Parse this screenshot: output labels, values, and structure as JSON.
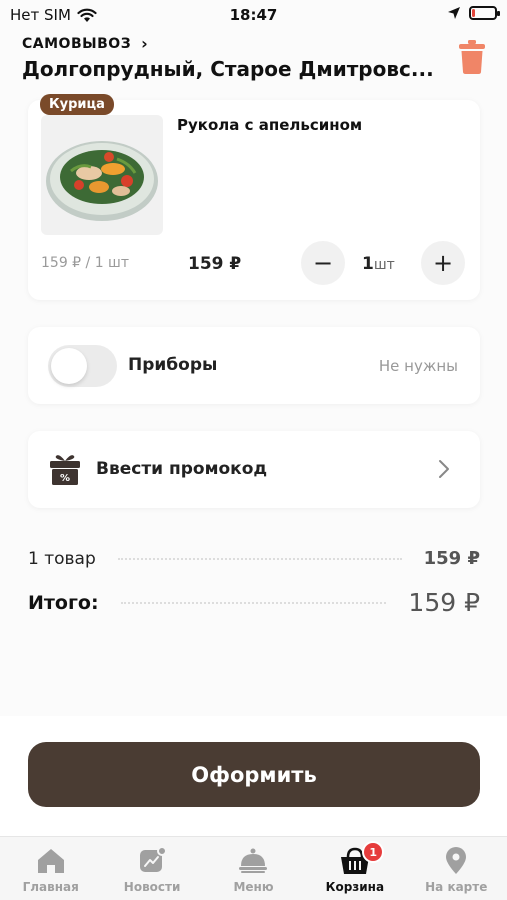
{
  "status_bar": {
    "carrier": "Нет SIM",
    "time": "18:47",
    "battery_level": 0.15
  },
  "header": {
    "mode_label": "САМОВЫВОЗ",
    "address": "Долгопрудный, Старое Дмитровс..."
  },
  "cart_item": {
    "tag": "Курица",
    "title": "Рукола с апельсином",
    "unit_price": "159 ₽ / 1 шт",
    "line_price": "159 ₽",
    "quantity": "1",
    "quantity_unit": "шт",
    "minus_symbol": "−",
    "plus_symbol": "+"
  },
  "cutlery": {
    "label": "Приборы",
    "value": "Не нужны",
    "enabled": false
  },
  "promo": {
    "label": "Ввести промокод"
  },
  "summary": {
    "items_label": "1 товар",
    "items_value": "159 ₽",
    "total_label": "Итого:",
    "total_value": "159 ₽"
  },
  "checkout": {
    "label": "Оформить"
  },
  "tabbar": {
    "active_color": "#111111",
    "inactive_color": "#a0a0a0",
    "badge_color": "#e63c3c",
    "items": [
      {
        "label": "Главная",
        "icon": "home-icon"
      },
      {
        "label": "Новости",
        "icon": "news-icon"
      },
      {
        "label": "Меню",
        "icon": "menu-cloche-icon"
      },
      {
        "label": "Корзина",
        "icon": "basket-icon",
        "badge": "1"
      },
      {
        "label": "На карте",
        "icon": "map-pin-icon"
      }
    ]
  },
  "colors": {
    "brand_dark": "#4a3c33",
    "tag_brown": "#7a4a2a",
    "trash_orange": "#f08567"
  }
}
